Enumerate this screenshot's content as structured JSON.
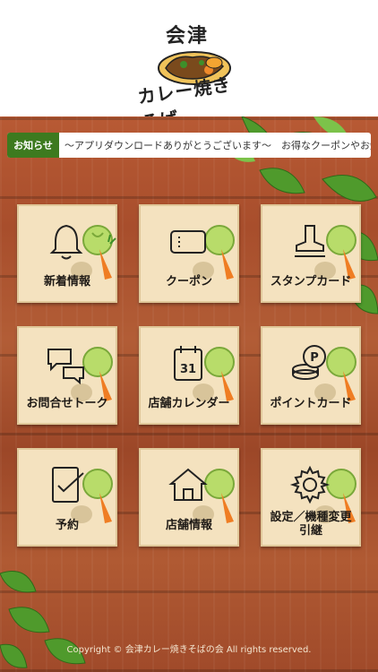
{
  "logo": {
    "top_text": "会津",
    "bottom_text": "カレー焼きそば"
  },
  "notice": {
    "tag": "お知らせ",
    "text": "〜アプリダウンロードありがとうございます〜　お得なクーポンやお知らせを"
  },
  "menu": [
    {
      "label": "新着情報",
      "icon": "bell-icon"
    },
    {
      "label": "クーポン",
      "icon": "coupon-icon"
    },
    {
      "label": "スタンプカード",
      "icon": "stamp-icon"
    },
    {
      "label": "お問合せトーク",
      "icon": "chat-icon"
    },
    {
      "label": "店舗カレンダー",
      "icon": "calendar-icon",
      "day": "31"
    },
    {
      "label": "ポイントカード",
      "icon": "coins-icon",
      "coin": "P"
    },
    {
      "label": "予約",
      "icon": "checklist-icon"
    },
    {
      "label": "店舗情報",
      "icon": "home-icon"
    },
    {
      "label": "設定／機種変更引継",
      "icon": "gear-icon"
    }
  ],
  "footer": {
    "copyright": "Copyright © 会津カレー焼きそばの会 All rights reserved."
  },
  "colors": {
    "notice_tag": "#3d7a1f",
    "tile_bg": "#f4e2bf",
    "wood": "#a84e2c"
  }
}
